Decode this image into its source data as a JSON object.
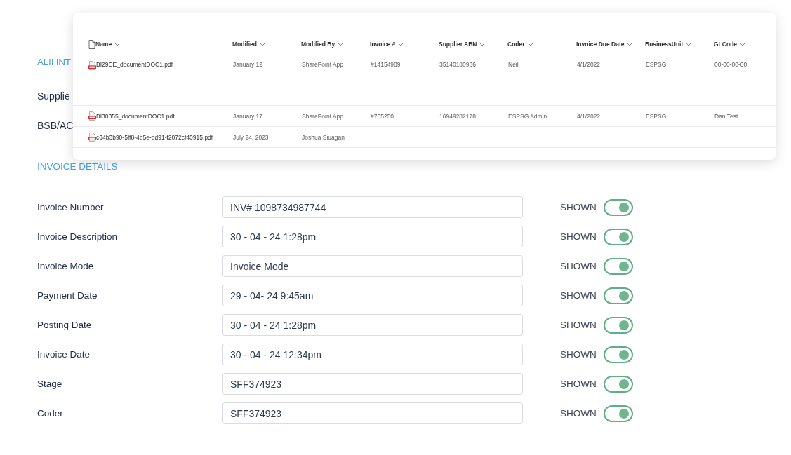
{
  "sections": [
    {
      "heading": "ALII INT",
      "labels": [
        "Supplie",
        "BSB/AC"
      ]
    }
  ],
  "library": {
    "columns": [
      "Name",
      "Modified",
      "Modified By",
      "Invoice #",
      "Supplier ABN",
      "Coder",
      "Invoice Due Date",
      "BusinessUnit",
      "GLCode"
    ],
    "rows": [
      {
        "tall": true,
        "cells": [
          "BI29CE_documentDOC1.pdf",
          "January 12",
          "SharePoint App",
          "#14154989",
          "35140180936",
          "Neil",
          "4/1/2022",
          "ESPSG",
          "00-00-00-00"
        ]
      },
      {
        "tall": false,
        "cells": [
          "BI30355_documentDOC1.pdf",
          "January 17",
          "SharePoint App",
          "#705250",
          "16949282178",
          "ESPSG Admin",
          "4/1/2022",
          "ESPSG",
          "Dan Test"
        ]
      },
      {
        "tall": false,
        "cells": [
          "c64b3b90-5ff8-4b5e-bd91-f2072cf40915.pdf",
          "July 24, 2023",
          "Joshua Siuagan",
          "",
          "",
          "",
          "",
          "",
          ""
        ]
      }
    ]
  },
  "invoice_details": {
    "heading": "INVOICE DETAILS",
    "fields": [
      {
        "label": "Invoice Number",
        "value": "INV# 1098734987744",
        "status": "SHOWN",
        "on": true
      },
      {
        "label": "Invoice Description",
        "value": "30 - 04 - 24 1:28pm",
        "status": "SHOWN",
        "on": true
      },
      {
        "label": "Invoice Mode",
        "value": "Invoice Mode",
        "status": "SHOWN",
        "on": true
      },
      {
        "label": "Payment Date",
        "value": "29 - 04- 24 9:45am",
        "status": "SHOWN",
        "on": true
      },
      {
        "label": "Posting Date",
        "value": "30 - 04 - 24 1:28pm",
        "status": "SHOWN",
        "on": true
      },
      {
        "label": "Invoice Date",
        "value": "30 - 04 - 24 12:34pm",
        "status": "SHOWN",
        "on": true
      },
      {
        "label": "Stage",
        "value": "SFF374923",
        "status": "SHOWN",
        "on": true
      },
      {
        "label": "Coder",
        "value": "SFF374923",
        "status": "SHOWN",
        "on": true
      }
    ]
  }
}
